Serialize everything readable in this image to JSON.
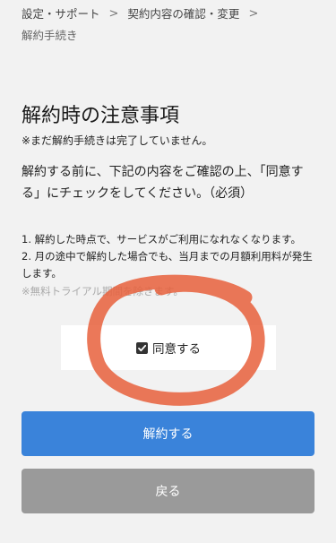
{
  "breadcrumb": {
    "items": [
      "設定・サポート",
      "契約内容の確認・変更"
    ],
    "separator": ">",
    "current": "解約手続き"
  },
  "page": {
    "title": "解約時の注意事項",
    "note": "※まだ解約手続きは完了していません。",
    "lead": "解約する前に、下記の内容をご確認の上、「同意する」にチェックをしてください。（必須）",
    "list": [
      "1. 解約した時点で、サービスがご利用になれなくなります。",
      "2. 月の途中で解約した場合でも、当月までの月額利用料が発生します。"
    ],
    "sub_note": "※無料トライアル期間を除きます。"
  },
  "agree": {
    "label": "同意する",
    "checked": true
  },
  "buttons": {
    "cancel_label": "解約する",
    "back_label": "戻る"
  },
  "colors": {
    "primary": "#3a83da",
    "secondary": "#9a9a9a",
    "annotation": "#e8603c"
  }
}
